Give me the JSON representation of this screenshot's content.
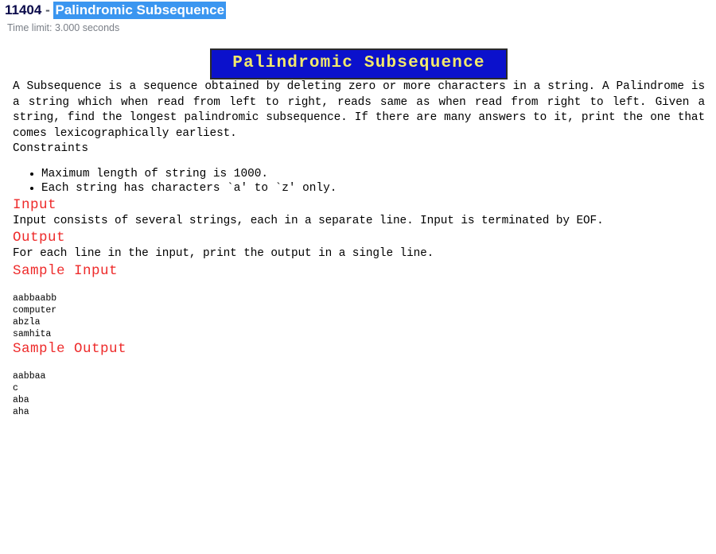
{
  "header": {
    "problem_number": "11404",
    "separator": "-",
    "problem_title": "Palindromic Subsequence",
    "time_limit": "Time limit: 3.000 seconds"
  },
  "banner": {
    "title": "Palindromic Subsequence",
    "background_color": "#0b11cc",
    "text_color": "#f2e96b",
    "border_color": "#2b2b2b"
  },
  "statement": {
    "intro": "A Subsequence is a sequence obtained by deleting zero or more characters in a string. A Palindrome is a string which when read from left to right, reads same as when read from right to left. Given a string, find the longest palindromic subsequence. If there are many answers to it, print the one that comes lexicographically earliest."
  },
  "constraints": {
    "heading": "Constraints",
    "items": [
      "Maximum length of string is 1000.",
      "Each string has characters `a' to `z' only."
    ]
  },
  "sections": {
    "input": {
      "heading": "Input",
      "text": "Input consists of several strings, each in a separate line. Input is terminated by EOF."
    },
    "output": {
      "heading": "Output",
      "text": "For each line in the input, print the output in a single line."
    },
    "sample_input": {
      "heading": "Sample Input",
      "text": "aabbaabb\ncomputer\nabzla\nsamhita"
    },
    "sample_output": {
      "heading": "Sample Output",
      "text": "aabbaa\nc\naba\naha"
    }
  },
  "colors": {
    "section_heading": "#ee2b2b",
    "selection_highlight": "#3b96f0",
    "problem_number": "#0a0a4a",
    "time_limit_text": "#7a7f87"
  }
}
